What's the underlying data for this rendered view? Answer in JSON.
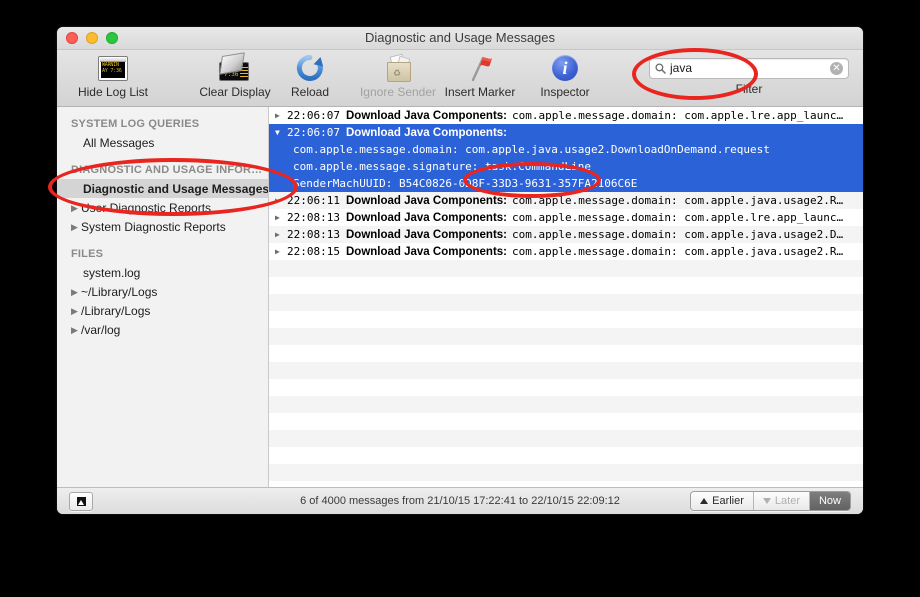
{
  "window": {
    "title": "Diagnostic and Usage Messages"
  },
  "traffic_lights": {
    "close": "close",
    "minimize": "minimize",
    "maximize": "maximize"
  },
  "toolbar": {
    "items": [
      {
        "label": "Hide Log List",
        "icon": "console-window-icon",
        "enabled": true,
        "icon_line1": "WARNIN",
        "icon_line2": "AY 7:36"
      },
      {
        "label": "Clear Display",
        "icon": "broom-icon",
        "enabled": true,
        "icon_text": "7:36"
      },
      {
        "label": "Reload",
        "icon": "reload-icon",
        "enabled": true
      },
      {
        "label": "Ignore Sender",
        "icon": "recycle-bag-icon",
        "enabled": false
      },
      {
        "label": "Insert Marker",
        "icon": "red-flag-icon",
        "enabled": true
      },
      {
        "label": "Inspector",
        "icon": "info-circle-icon",
        "enabled": true,
        "glyph": "i"
      }
    ]
  },
  "search": {
    "value": "java",
    "placeholder": "",
    "label": "Filter",
    "search_icon": "search-icon",
    "clear_icon": "✕"
  },
  "sidebar": {
    "sections": [
      {
        "header": "SYSTEM LOG QUERIES",
        "items": [
          {
            "label": "All Messages",
            "disclosure": "",
            "selected": false,
            "indent": true
          }
        ]
      },
      {
        "header": "DIAGNOSTIC AND USAGE INFOR…",
        "items": [
          {
            "label": "Diagnostic and Usage Messages",
            "disclosure": "",
            "selected": true,
            "indent": true
          },
          {
            "label": "User Diagnostic Reports",
            "disclosure": "▶",
            "selected": false,
            "indent": false
          },
          {
            "label": "System Diagnostic Reports",
            "disclosure": "▶",
            "selected": false,
            "indent": false
          }
        ]
      },
      {
        "header": "FILES",
        "items": [
          {
            "label": "system.log",
            "disclosure": "",
            "selected": false,
            "indent": true
          },
          {
            "label": "~/Library/Logs",
            "disclosure": "▶",
            "selected": false,
            "indent": false
          },
          {
            "label": "/Library/Logs",
            "disclosure": "▶",
            "selected": false,
            "indent": false
          },
          {
            "label": "/var/log",
            "disclosure": "▶",
            "selected": false,
            "indent": false
          }
        ]
      }
    ]
  },
  "log_list": {
    "rows": [
      {
        "disclosure": "▶",
        "time": "22:06:07",
        "sender": "Download Java Components:",
        "message": "com.apple.message.domain: com.apple.lre.app_launc…",
        "selected": false
      },
      {
        "disclosure": "▼",
        "time": "22:06:07",
        "sender": "Download Java Components:",
        "message": "",
        "selected": true,
        "details": [
          "com.apple.message.domain: com.apple.java.usage2.DownloadOnDemand.request",
          "com.apple.message.signature: task:CommandLine",
          "SenderMachUUID: B54C0826-0D8F-33D3-9631-357FA2106C6E"
        ]
      },
      {
        "disclosure": "▶",
        "time": "22:06:11",
        "sender": "Download Java Components:",
        "message": "com.apple.message.domain: com.apple.java.usage2.R…",
        "selected": false
      },
      {
        "disclosure": "▶",
        "time": "22:08:13",
        "sender": "Download Java Components:",
        "message": "com.apple.message.domain: com.apple.lre.app_launc…",
        "selected": false
      },
      {
        "disclosure": "▶",
        "time": "22:08:13",
        "sender": "Download Java Components:",
        "message": "com.apple.message.domain: com.apple.java.usage2.D…",
        "selected": false
      },
      {
        "disclosure": "▶",
        "time": "22:08:15",
        "sender": "Download Java Components:",
        "message": "com.apple.message.domain: com.apple.java.usage2.R…",
        "selected": false
      }
    ]
  },
  "status_bar": {
    "left_button_icon": "show-window-icon",
    "message": "6 of 4000 messages from 21/10/15 17:22:41 to 22/10/15 22:09:12",
    "nav": [
      {
        "label": "Earlier",
        "arrow": "up",
        "state": "enabled"
      },
      {
        "label": "Later",
        "arrow": "down",
        "state": "disabled"
      },
      {
        "label": "Now",
        "arrow": "none",
        "state": "active"
      }
    ]
  },
  "annotations": {
    "color": "#e8251e",
    "shapes": [
      {
        "name": "search-field-highlight",
        "target": "search"
      },
      {
        "name": "sidebar-item-highlight",
        "target": "sidebar-diagnostic-usage-messages"
      },
      {
        "name": "message-signature-highlight",
        "target": "log-detail-signature"
      }
    ]
  }
}
